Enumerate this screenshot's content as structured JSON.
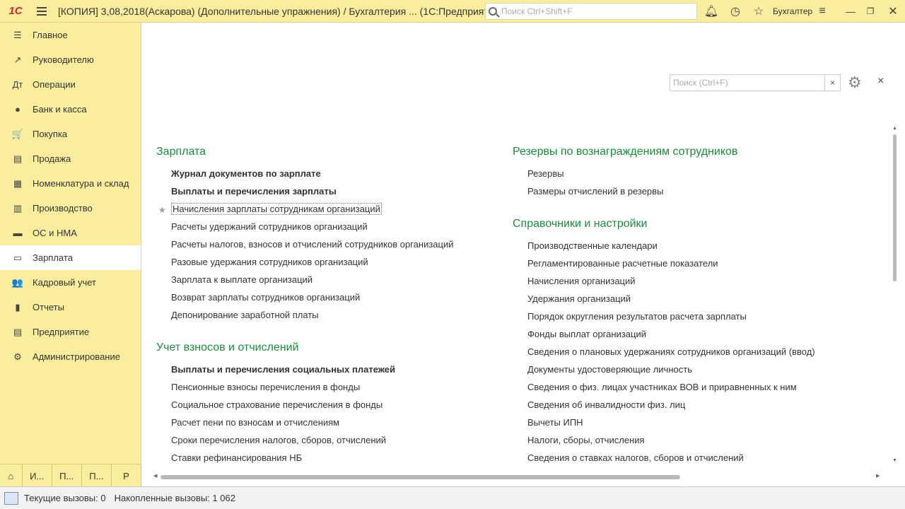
{
  "titlebar": {
    "logo": "1С",
    "title": "[КОПИЯ] 3,08,2018(Аскарова) (Дополнительные упражнения) / Бухгалтерия ...  (1С:Предприятие)",
    "search_placeholder": "Поиск Ctrl+Shift+F",
    "user": "Бухгалтер",
    "icons": [
      "bell-icon",
      "history-icon",
      "star-icon",
      "settings-menu-icon",
      "restore-icon",
      "close-icon"
    ]
  },
  "sidebar": {
    "items": [
      {
        "label": "Главное",
        "icon": "☰"
      },
      {
        "label": "Руководителю",
        "icon": "↗"
      },
      {
        "label": "Операции",
        "icon": "Дт"
      },
      {
        "label": "Банк и касса",
        "icon": "●"
      },
      {
        "label": "Покупка",
        "icon": "🛒"
      },
      {
        "label": "Продажа",
        "icon": "▤"
      },
      {
        "label": "Номенклатура и склад",
        "icon": "▦"
      },
      {
        "label": "Производство",
        "icon": "▥"
      },
      {
        "label": "ОС и НМА",
        "icon": "▬"
      },
      {
        "label": "Зарплата",
        "icon": "▭",
        "active": true
      },
      {
        "label": "Кадровый учет",
        "icon": "👥"
      },
      {
        "label": "Отчеты",
        "icon": "▮"
      },
      {
        "label": "Предприятие",
        "icon": "▤"
      },
      {
        "label": "Администрирование",
        "icon": "⚙"
      }
    ]
  },
  "bottom_tabs": [
    "И...",
    "П...",
    "П...",
    "Р"
  ],
  "statusbar": {
    "current_calls": "Текущие вызовы: 0",
    "accumulated_calls": "Накопленные вызовы: 1 062"
  },
  "main": {
    "search_placeholder": "Поиск (Ctrl+F)",
    "search_clear": "×",
    "close": "×",
    "left_sections": [
      {
        "title": "Зарплата",
        "links": [
          {
            "label": "Журнал документов по зарплате",
            "bold": true
          },
          {
            "label": "Выплаты и перечисления зарплаты",
            "bold": true
          },
          {
            "label": "Начисления зарплаты сотрудникам организаций",
            "starred": true,
            "focused": true
          },
          {
            "label": "Расчеты удержаний сотрудников организаций"
          },
          {
            "label": "Расчеты налогов, взносов и отчислений сотрудников организаций"
          },
          {
            "label": "Разовые удержания сотрудников организаций"
          },
          {
            "label": "Зарплата к выплате организаций"
          },
          {
            "label": "Возврат зарплаты сотрудников организаций"
          },
          {
            "label": "Депонирование заработной платы"
          }
        ]
      },
      {
        "title": "Учет взносов и отчислений",
        "links": [
          {
            "label": "Выплаты и перечисления социальных платежей",
            "bold": true
          },
          {
            "label": "Пенсионные взносы перечисления в фонды"
          },
          {
            "label": "Социальное страхование перечисления в фонды"
          },
          {
            "label": "Расчет пени по взносам и отчислениям"
          },
          {
            "label": "Сроки перечисления налогов, сборов, отчислений"
          },
          {
            "label": "Ставки рефинансирования НБ"
          }
        ]
      }
    ],
    "right_sections": [
      {
        "title": "Резервы по вознаграждениям сотрудников",
        "links": [
          {
            "label": "Резервы"
          },
          {
            "label": "Размеры отчислений в резервы"
          }
        ]
      },
      {
        "title": "Справочники и настройки",
        "links": [
          {
            "label": "Производственные календари"
          },
          {
            "label": "Регламентированные расчетные показатели"
          },
          {
            "label": "Начисления организаций"
          },
          {
            "label": "Удержания организаций"
          },
          {
            "label": "Порядок округления результатов расчета зарплаты"
          },
          {
            "label": "Фонды выплат организаций"
          },
          {
            "label": "Сведения о плановых удержаниях сотрудников организаций (ввод)"
          },
          {
            "label": "Документы удостоверяющие личность"
          },
          {
            "label": "Сведения о физ. лицах участниках ВОВ и приравненных к ним"
          },
          {
            "label": "Сведения об инвалидности физ. лиц"
          },
          {
            "label": "Вычеты ИПН"
          },
          {
            "label": "Налоги, сборы, отчисления"
          },
          {
            "label": "Сведения о ставках налогов, сборов и отчислений"
          }
        ]
      }
    ]
  }
}
